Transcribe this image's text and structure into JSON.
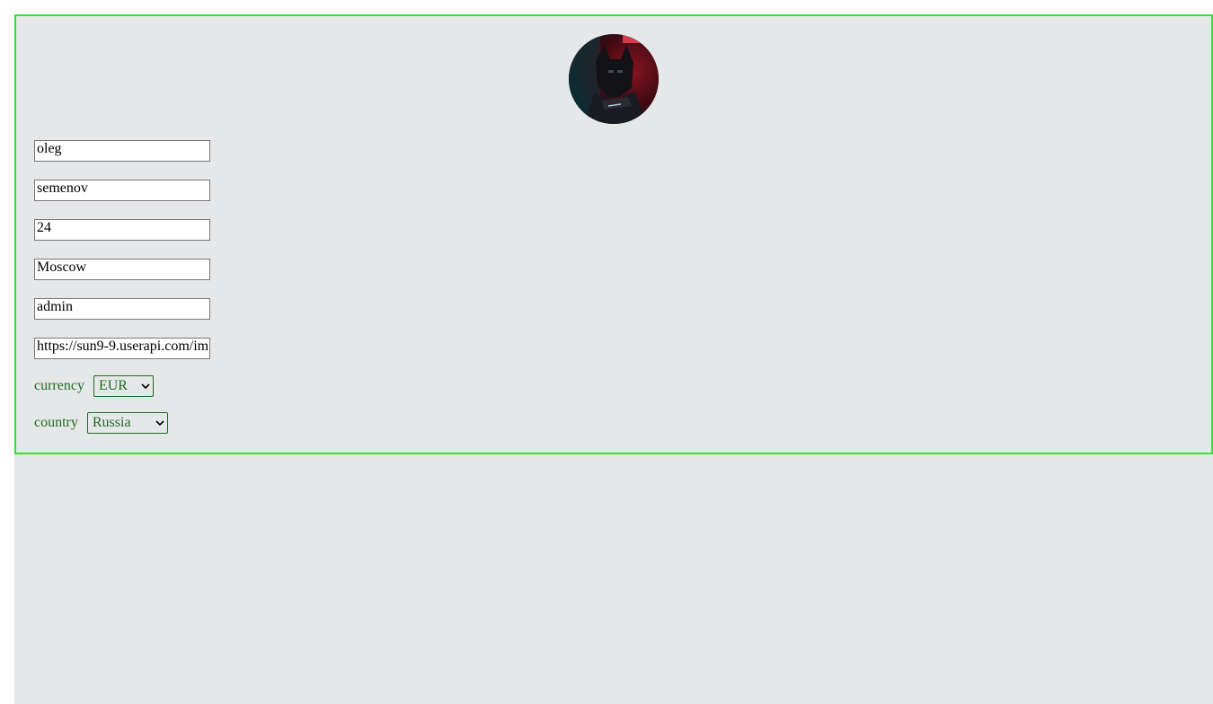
{
  "profile": {
    "first_name": "oleg",
    "last_name": "semenov",
    "age": "24",
    "city": "Moscow",
    "role": "admin",
    "avatar_url": "https://sun9-9.userapi.com/im"
  },
  "currency": {
    "label": "currency",
    "selected": "EUR"
  },
  "country": {
    "label": "country",
    "selected": "Russia"
  },
  "colors": {
    "card_border": "#2ee62e",
    "label_text": "#1f6b1f",
    "background": "#e6e7e9"
  }
}
